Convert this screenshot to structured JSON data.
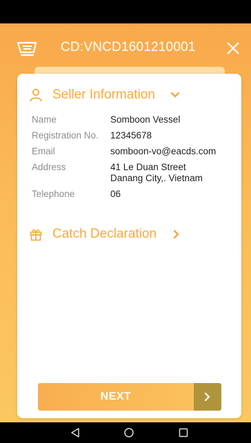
{
  "header": {
    "title": "CD:VNCD1601210001",
    "icons": [
      "cart-icon",
      "close-icon"
    ]
  },
  "seller_section": {
    "title": "Seller Information",
    "icon": "user-icon",
    "expanded_icon": "chevron-down-icon",
    "fields": [
      {
        "label": "Name",
        "value": "Somboon Vessel"
      },
      {
        "label": "Registration No.",
        "value": "12345678"
      },
      {
        "label": "Email",
        "value": "somboon-vo@eacds.com"
      },
      {
        "label": "Address",
        "value_line1": "41 Le Duan Street",
        "value_line2": "Danang City,. Vietnam"
      },
      {
        "label": "Telephone",
        "value": "06"
      }
    ]
  },
  "catch_section": {
    "title": "Catch Declaration",
    "icon": "gift-box-icon",
    "collapsed_icon": "chevron-right-icon"
  },
  "next_button": {
    "label": "NEXT",
    "icon": "chevron-right-icon"
  },
  "system_nav": {
    "icons": [
      "back-triangle-icon",
      "home-circle-icon",
      "recents-square-icon"
    ]
  },
  "colors": {
    "accent": "#f6a93b",
    "header_gradient_top": "#f9a94b",
    "header_gradient_bottom": "#fcc760",
    "next_arrow_bg": "#b0943c"
  }
}
